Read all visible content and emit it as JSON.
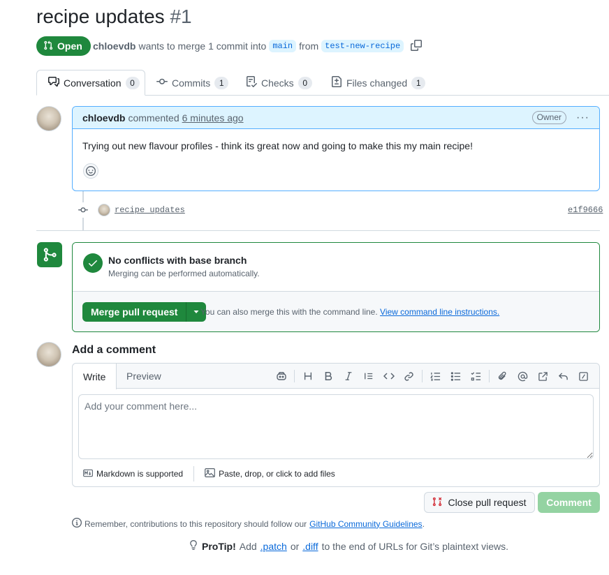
{
  "pr": {
    "title": "recipe updates",
    "number": "#1",
    "state": "Open",
    "author": "chloevdb",
    "merge_text": "wants to merge 1 commit into",
    "base_branch": "main",
    "from_text": "from",
    "head_branch": "test-new-recipe"
  },
  "tabs": [
    {
      "label": "Conversation",
      "count": "0",
      "icon": "comment-discussion-icon"
    },
    {
      "label": "Commits",
      "count": "1",
      "icon": "git-commit-icon"
    },
    {
      "label": "Checks",
      "count": "0",
      "icon": "checklist-icon"
    },
    {
      "label": "Files changed",
      "count": "1",
      "icon": "file-diff-icon"
    }
  ],
  "comment": {
    "author": "chloevdb",
    "action": "commented",
    "time": "6 minutes ago",
    "role": "Owner",
    "body": "Trying out new flavour profiles - think its great now and going to make this my main recipe!"
  },
  "commit": {
    "message": "recipe updates",
    "sha": "e1f9666"
  },
  "merge": {
    "title": "No conflicts with base branch",
    "subtitle": "Merging can be performed automatically.",
    "button": "Merge pull request",
    "note": "You can also merge this with the command line.",
    "link": "View command line instructions."
  },
  "add_comment": {
    "title": "Add a comment",
    "tab_write": "Write",
    "tab_preview": "Preview",
    "placeholder": "Add your comment here...",
    "markdown": "Markdown is supported",
    "attach": "Paste, drop, or click to add files"
  },
  "actions": {
    "close": "Close pull request",
    "comment": "Comment"
  },
  "footer": {
    "remember": "Remember, contributions to this repository should follow our",
    "guidelines": "GitHub Community Guidelines",
    "period": ".",
    "protip_label": "ProTip!",
    "protip_add": "Add",
    "patch": ".patch",
    "or": "or",
    "diff": ".diff",
    "protip_rest": "to the end of URLs for Git’s plaintext views."
  },
  "colors": {
    "accent_green": "#1f883d",
    "link_blue": "#0969da",
    "comment_header": "#ddf4ff"
  }
}
